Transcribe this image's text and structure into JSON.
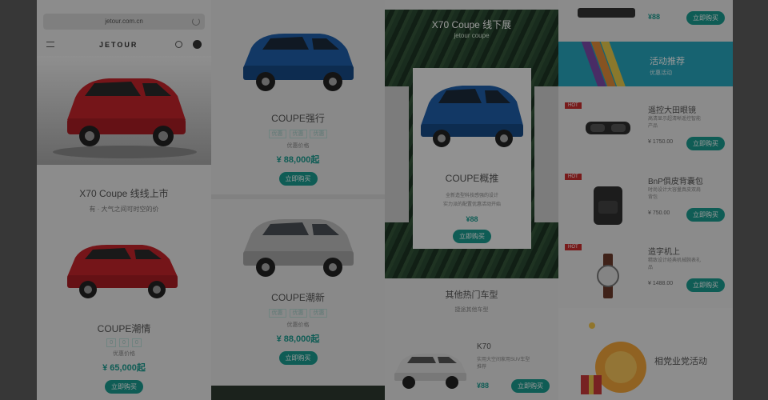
{
  "col1": {
    "url": "jetour.com.cn",
    "brand": "JETOUR",
    "promo_title": "X70 Coupe 线线上市",
    "promo_sub": "有 · 大气之间可时空的价",
    "product": {
      "name": "COUPE潮情",
      "tags": [
        "0",
        "0",
        "0"
      ],
      "small": "优惠价格",
      "price": "¥ 65,000起",
      "button": "立即购买"
    }
  },
  "col2": {
    "products": [
      {
        "name": "COUPE强行",
        "tags": [
          "优惠",
          "优惠",
          "优惠"
        ],
        "small": "优惠价格",
        "price": "¥ 88,000起",
        "button": "立即购买"
      },
      {
        "name": "COUPE潮新",
        "tags": [
          "优惠",
          "优惠",
          "优惠"
        ],
        "small": "优惠价格",
        "price": "¥ 88,000起",
        "button": "立即购买"
      }
    ]
  },
  "col3": {
    "banner_title": "X70 Coupe 线下展",
    "banner_sub": "jetour coupe",
    "popup": {
      "name": "COUPE概推",
      "desc1": "全新造型科技感强的设计",
      "desc2": "实力派的配置优惠活动开始",
      "price": "¥88",
      "button": "立即购买"
    },
    "lower_title": "其他热门车型",
    "lower_sub": "捷途其他车型",
    "k70": {
      "name": "K70",
      "desc": "实用大空间家用SUV车型推荐",
      "price": "¥88",
      "button": "立即购买"
    }
  },
  "col4": {
    "top_item": {
      "price": "¥88",
      "button": "立即购买"
    },
    "activity": {
      "title": "活动推荐",
      "sub": "优惠活动"
    },
    "hot_tag": "HOT",
    "items": [
      {
        "name": "遥控大田眼镜",
        "desc": "高清显示超清晰遥控智能产品",
        "price": "¥ 1750.00",
        "button": "立即购买"
      },
      {
        "name": "BnP俱皮背囊包",
        "desc": "时尚设计大容量真皮双肩背包",
        "price": "¥ 750.00",
        "button": "立即购买"
      },
      {
        "name": "造字机上",
        "desc": "精致设计经典机械腕表礼品",
        "price": "¥ 1488.00",
        "button": "立即购买"
      }
    ],
    "bottom_title": "相党业党活动"
  },
  "colors": {
    "accent": "#1a9a8e",
    "activity_banner": "#27a6bd",
    "hot": "#c82d2d"
  }
}
